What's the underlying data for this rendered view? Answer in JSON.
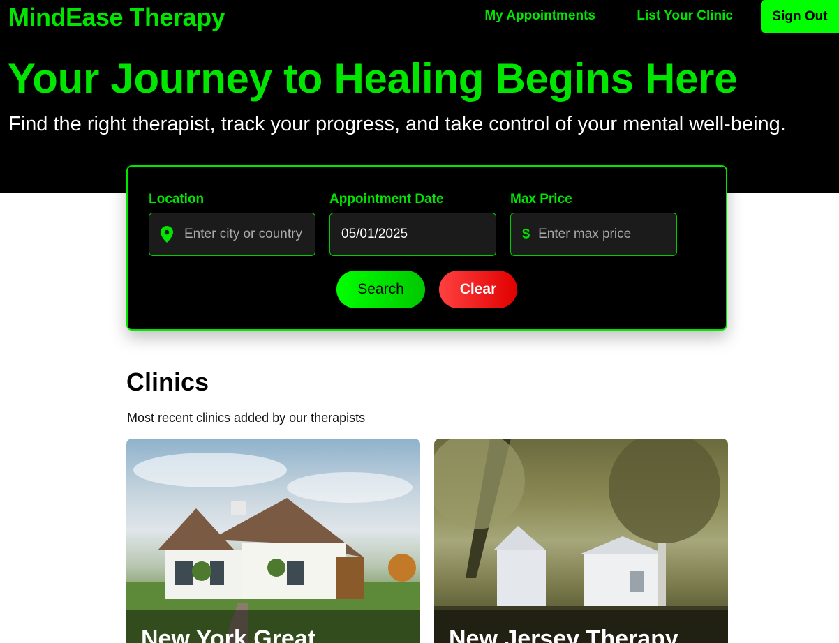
{
  "brand": "MindEase Therapy",
  "nav": {
    "appointments": "My Appointments",
    "list_clinic": "List Your Clinic",
    "sign_out": "Sign Out"
  },
  "hero": {
    "title": "Your Journey to Healing Begins Here",
    "subtitle": "Find the right therapist, track your progress, and take control of your mental well-being."
  },
  "search": {
    "location": {
      "label": "Location",
      "placeholder": "Enter city or country",
      "icon": "map-pin-icon"
    },
    "date": {
      "label": "Appointment Date",
      "value": "05/01/2025"
    },
    "price": {
      "label": "Max Price",
      "placeholder": "Enter max price",
      "icon": "dollar-icon",
      "symbol": "$"
    },
    "search_label": "Search",
    "clear_label": "Clear"
  },
  "clinics": {
    "title": "Clinics",
    "subtitle": "Most recent clinics added by our therapists",
    "items": [
      {
        "name": "New York Great"
      },
      {
        "name": "New Jersey Therapy"
      }
    ]
  },
  "colors": {
    "accent": "#00e600",
    "danger": "#e00000",
    "background": "#000000"
  }
}
